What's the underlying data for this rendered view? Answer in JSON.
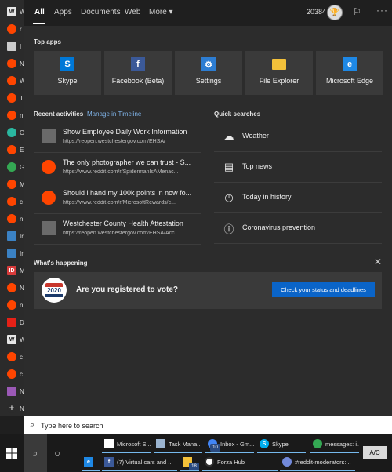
{
  "background_strip": [
    {
      "icon": "window-icon",
      "color": "#e6e6e6",
      "letter": "W",
      "text": "W"
    },
    {
      "icon": "reddit-icon",
      "color": "#ff4500",
      "letter": "",
      "text": "r"
    },
    {
      "icon": "document-icon",
      "color": "#cccccc",
      "letter": "",
      "text": "I"
    },
    {
      "icon": "reddit-icon",
      "color": "#ff4500",
      "letter": "",
      "text": "N"
    },
    {
      "icon": "reddit-icon",
      "color": "#ff4500",
      "letter": "",
      "text": "W"
    },
    {
      "icon": "reddit-icon",
      "color": "#ff4500",
      "letter": "",
      "text": "T"
    },
    {
      "icon": "reddit-icon",
      "color": "#ff4500",
      "letter": "",
      "text": "n"
    },
    {
      "icon": "globe-icon",
      "color": "#2ab7a0",
      "letter": "",
      "text": "O"
    },
    {
      "icon": "reddit-icon",
      "color": "#ff4500",
      "letter": "",
      "text": "E"
    },
    {
      "icon": "maps-icon",
      "color": "#34a853",
      "letter": "",
      "text": "G"
    },
    {
      "icon": "reddit-icon",
      "color": "#ff4500",
      "letter": "",
      "text": "M"
    },
    {
      "icon": "reddit-icon",
      "color": "#ff4500",
      "letter": "",
      "text": "c"
    },
    {
      "icon": "reddit-icon",
      "color": "#ff4500",
      "letter": "",
      "text": "n"
    },
    {
      "icon": "monitor-icon",
      "color": "#3b82c4",
      "letter": "",
      "text": "Ir"
    },
    {
      "icon": "monitor-icon",
      "color": "#3b82c4",
      "letter": "",
      "text": "Ir"
    },
    {
      "icon": "id-icon",
      "color": "#d83b3b",
      "letter": "ID",
      "text": "M"
    },
    {
      "icon": "reddit-icon",
      "color": "#ff4500",
      "letter": "",
      "text": "N"
    },
    {
      "icon": "reddit-icon",
      "color": "#ff4500",
      "letter": "",
      "text": "n"
    },
    {
      "icon": "youtube-icon",
      "color": "#e62117",
      "letter": "",
      "text": "D"
    },
    {
      "icon": "window-icon",
      "color": "#e6e6e6",
      "letter": "W",
      "text": "W"
    },
    {
      "icon": "reddit-icon",
      "color": "#ff4500",
      "letter": "",
      "text": "c"
    },
    {
      "icon": "reddit-icon",
      "color": "#ff4500",
      "letter": "",
      "text": "c"
    },
    {
      "icon": "multicolor-icon",
      "color": "#9b59b6",
      "letter": "",
      "text": "N"
    },
    {
      "icon": "add-icon",
      "color": "#2b2b2b",
      "letter": "+",
      "text": "N"
    }
  ],
  "tabs": {
    "all": "All",
    "apps": "Apps",
    "documents": "Documents",
    "web": "Web",
    "more": "More ▾"
  },
  "header": {
    "points": "20384",
    "avatar_icon": "trophy-icon",
    "feedback_icon": "feedback-icon",
    "more_icon": "ellipsis-icon"
  },
  "top_apps": {
    "title": "Top apps",
    "items": [
      {
        "label": "Skype",
        "icon": "skype-icon",
        "color": "#0078d7",
        "glyph": "S"
      },
      {
        "label": "Facebook (Beta)",
        "icon": "facebook-icon",
        "color": "#3b5998",
        "glyph": "f"
      },
      {
        "label": "Settings",
        "icon": "gear-icon",
        "color": "#2d7dd2",
        "glyph": "⚙"
      },
      {
        "label": "File Explorer",
        "icon": "folder-icon",
        "color": "#f3c13a",
        "glyph": ""
      },
      {
        "label": "Microsoft Edge",
        "icon": "edge-icon",
        "color": "#1e88e5",
        "glyph": "e"
      }
    ]
  },
  "recent": {
    "title": "Recent activities",
    "manage_link": "Manage in Timeline",
    "items": [
      {
        "title": "Show Employee Daily Work Information",
        "url": "https://reopen.westchestergov.com/EHSA/",
        "icon": "page-icon"
      },
      {
        "title": "The only photographer we can trust - S...",
        "url": "https://www.reddit.com/r/SpidermanIsAMenac...",
        "icon": "reddit-icon"
      },
      {
        "title": "Should i hand my 100k points in now fo...",
        "url": "https://www.reddit.com/r/MicrosoftRewards/c...",
        "icon": "reddit-icon"
      },
      {
        "title": "Westchester County Health Attestation",
        "url": "https://reopen.westchestergov.com/EHSA/Acc...",
        "icon": "page-icon"
      }
    ]
  },
  "quick": {
    "title": "Quick searches",
    "items": [
      {
        "label": "Weather",
        "icon": "weather-icon",
        "glyph": "☁"
      },
      {
        "label": "Top news",
        "icon": "news-icon",
        "glyph": "▤"
      },
      {
        "label": "Today in history",
        "icon": "clock-icon",
        "glyph": "◷"
      },
      {
        "label": "Coronavirus prevention",
        "icon": "info-icon",
        "glyph": "ⓘ"
      }
    ]
  },
  "happening": {
    "title": "What's happening",
    "badge_year": "2020",
    "text": "Are you registered to vote?",
    "button": "Check your status and deadlines"
  },
  "search": {
    "placeholder": "Type here to search"
  },
  "taskbar": {
    "accent": "#76b9ed",
    "apps_row1": [
      {
        "label": "Microsoft S...",
        "icon": "store-icon",
        "color": "#ffffff",
        "glyph": ""
      },
      {
        "label": "Task Mana...",
        "icon": "task-manager-icon",
        "color": "#9bb4d0",
        "glyph": ""
      },
      {
        "label": "Inbox - Gm...",
        "icon": "chrome-icon",
        "color": "#4285f4",
        "glyph": ""
      },
      {
        "label": "Skype",
        "icon": "skype-icon",
        "color": "#00aff0",
        "glyph": "S"
      },
      {
        "label": "messages: i...",
        "icon": "chrome-icon",
        "color": "#34a853",
        "glyph": ""
      }
    ],
    "apps_row2": [
      {
        "label": "",
        "icon": "edge-icon",
        "color": "#1e88e5",
        "glyph": "e"
      },
      {
        "label": "(7) Virtual cars and ...",
        "icon": "facebook-icon",
        "color": "#3b5998",
        "glyph": "f"
      },
      {
        "label": "",
        "icon": "file-explorer-icon",
        "color": "#f3c13a",
        "glyph": ""
      },
      {
        "label": "Forza Hub",
        "icon": "forza-icon",
        "color": "#ffffff",
        "glyph": ""
      },
      {
        "label": "#reddit-moderators:...",
        "icon": "discord-icon",
        "color": "#7289da",
        "glyph": ""
      }
    ],
    "badges": {
      "inbox": "10",
      "explorer": "18"
    },
    "ac_label": "A/C"
  }
}
